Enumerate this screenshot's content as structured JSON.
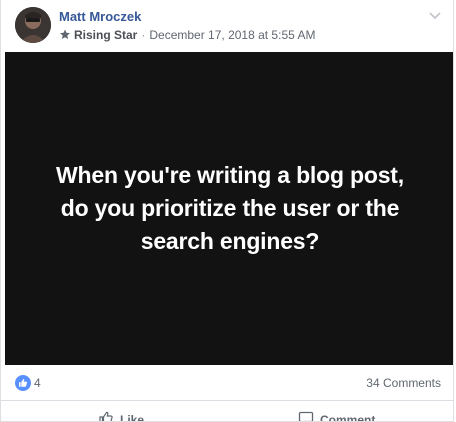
{
  "post": {
    "author": "Matt Mroczek",
    "badge": "Rising Star",
    "separator": "·",
    "timestamp": "December 17, 2018 at 5:55 AM",
    "media_text": "When you're writing a blog post, do you prioritize the user or the search engines?"
  },
  "reactions": {
    "like_count": "4",
    "comments_count": "34 Comments"
  },
  "actions": {
    "like_label": "Like",
    "comment_label": "Comment"
  },
  "colors": {
    "author_blue": "#365899",
    "like_blue": "#5890ff",
    "media_bg": "#121212"
  },
  "icons": [
    "avatar",
    "rising-star-icon",
    "chevron-down-icon",
    "like-reaction-icon",
    "like-icon",
    "comment-icon"
  ]
}
